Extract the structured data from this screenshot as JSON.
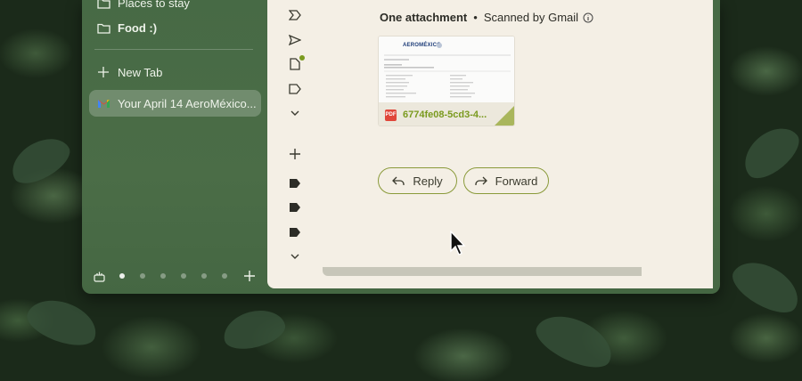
{
  "sidebar": {
    "items": [
      {
        "label": "Places to stay",
        "icon": "folder-icon"
      },
      {
        "label": "Food :)",
        "icon": "folder-icon"
      }
    ],
    "new_tab_label": "New Tab",
    "active_tab": {
      "label": "Your April 14 AeroMéxico...",
      "icon": "gmail-icon"
    },
    "space_dots": 6,
    "active_dot": 0
  },
  "email": {
    "attachment_header": "One attachment",
    "separator": "•",
    "scan_note": "Scanned by Gmail",
    "attachment": {
      "type": "PDF",
      "filename": "6774fe08-5cd3-4...",
      "brand": "AEROMÉXICO"
    },
    "reply_label": "Reply",
    "forward_label": "Forward"
  },
  "colors": {
    "accent_green": "#7a9a1e",
    "pdf_red": "#e0463a",
    "sidebar_bg": "#4b6d47",
    "content_bg": "#f4efe5"
  }
}
